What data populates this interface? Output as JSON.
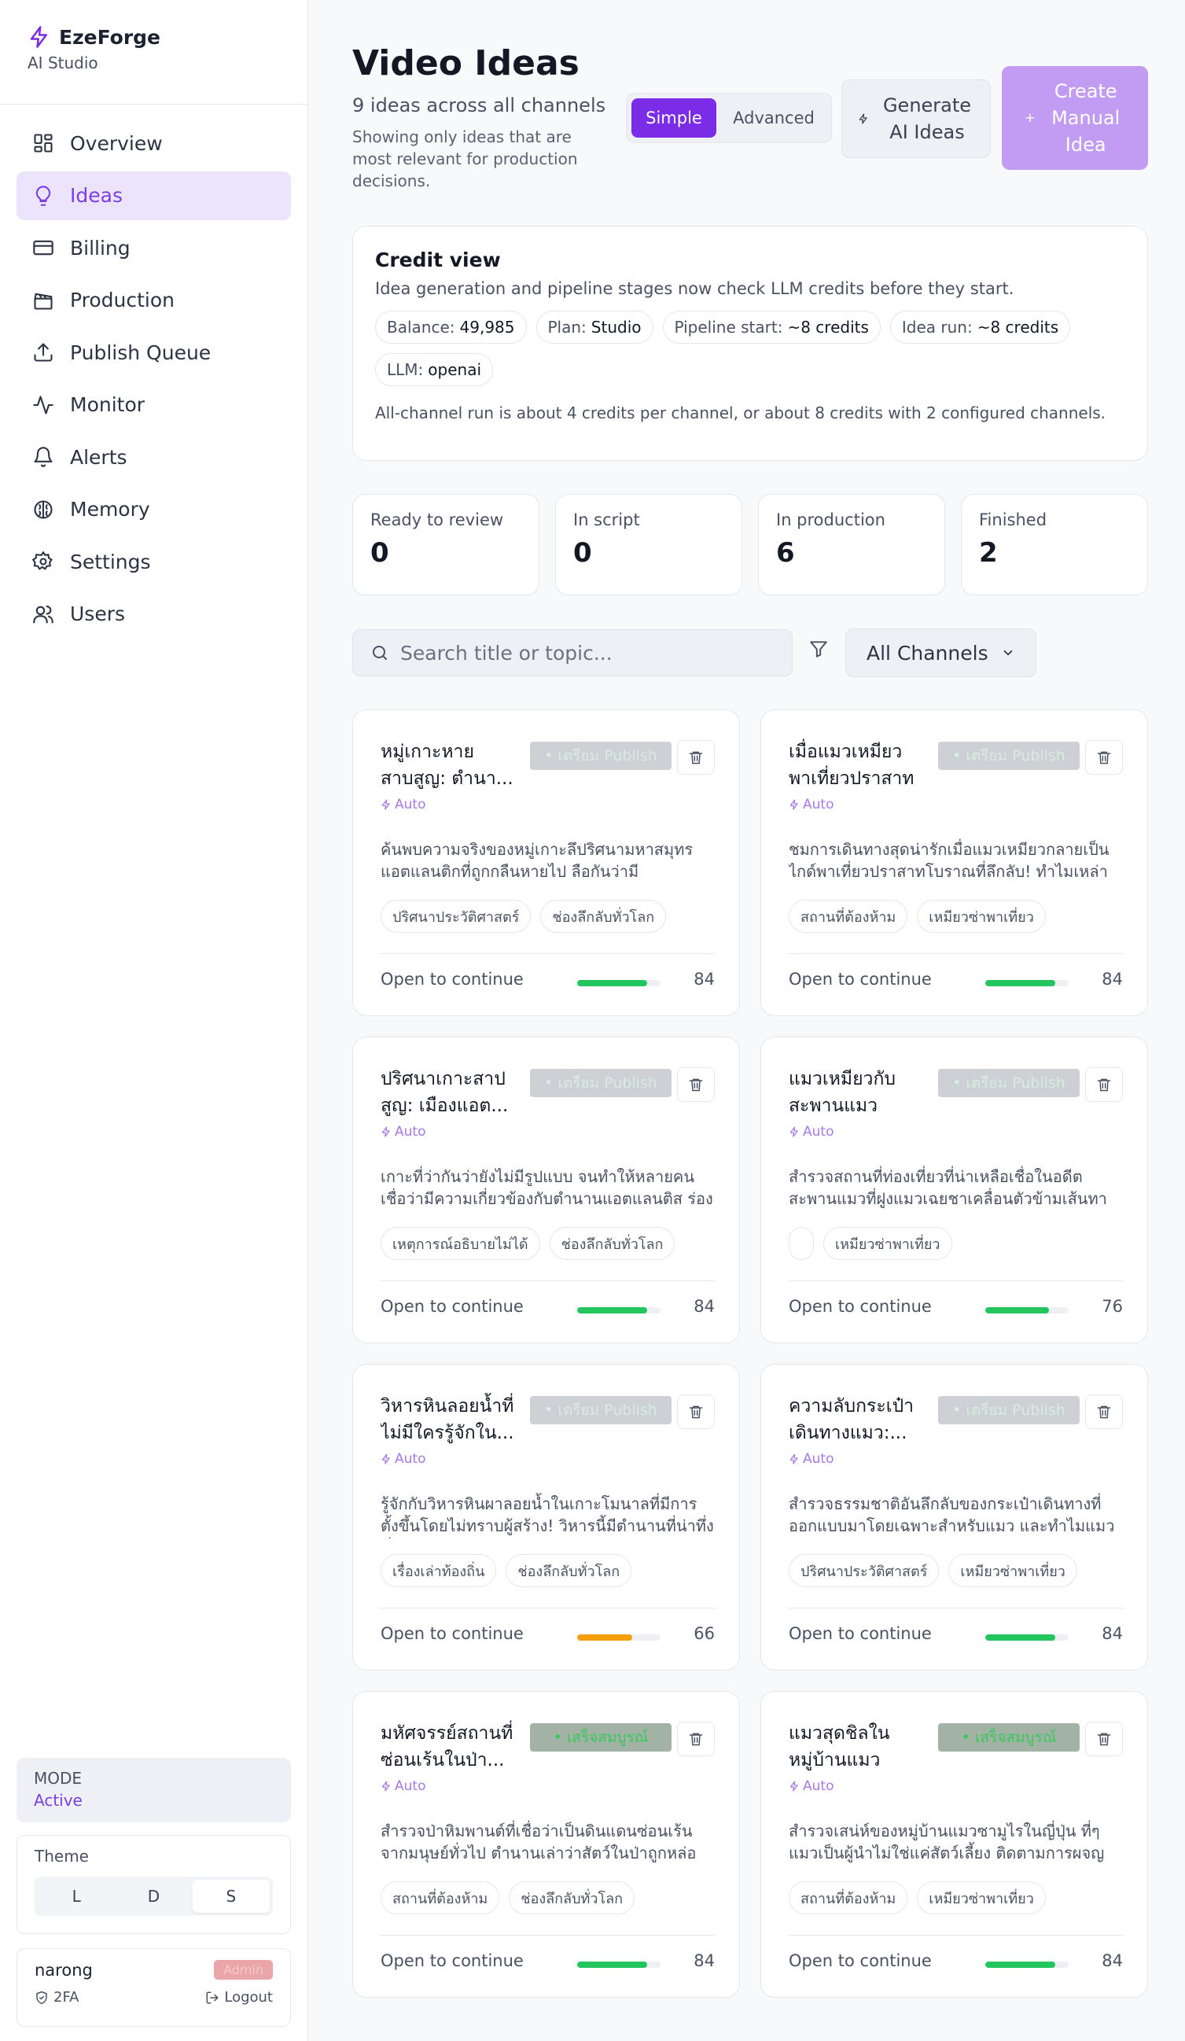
{
  "brand": {
    "name": "EzeForge",
    "sub": "AI Studio"
  },
  "nav": [
    {
      "label": "Overview",
      "icon": "grid-icon",
      "active": false
    },
    {
      "label": "Ideas",
      "icon": "lightbulb-icon",
      "active": true
    },
    {
      "label": "Billing",
      "icon": "credit-card-icon",
      "active": false
    },
    {
      "label": "Production",
      "icon": "clapperboard-icon",
      "active": false
    },
    {
      "label": "Publish Queue",
      "icon": "upload-icon",
      "active": false
    },
    {
      "label": "Monitor",
      "icon": "activity-icon",
      "active": false
    },
    {
      "label": "Alerts",
      "icon": "bell-icon",
      "active": false
    },
    {
      "label": "Memory",
      "icon": "brain-icon",
      "active": false
    },
    {
      "label": "Settings",
      "icon": "gear-icon",
      "active": false
    },
    {
      "label": "Users",
      "icon": "users-icon",
      "active": false
    }
  ],
  "mode": {
    "label": "MODE",
    "value": "Active"
  },
  "theme": {
    "label": "Theme",
    "options": [
      "L",
      "D",
      "S"
    ],
    "selected": "S"
  },
  "user": {
    "name": "narong",
    "badge": "Admin",
    "twofa": "2FA",
    "logout": "Logout"
  },
  "header": {
    "title": "Video Ideas",
    "subtitle": "9 ideas across all channels",
    "desc": "Showing only ideas that are most relevant for production decisions.",
    "seg_simple": "Simple",
    "seg_advanced": "Advanced",
    "generate": "Generate AI Ideas",
    "create": "Create Manual Idea"
  },
  "credit": {
    "title": "Credit view",
    "desc": "Idea generation and pipeline stages now check LLM credits before they start.",
    "chips": [
      {
        "k": "Balance:",
        "v": "49,985"
      },
      {
        "k": "Plan:",
        "v": "Studio"
      },
      {
        "k": "Pipeline start:",
        "v": "~8 credits"
      },
      {
        "k": "Idea run:",
        "v": "~8 credits"
      },
      {
        "k": "LLM:",
        "v": "openai"
      }
    ],
    "note": "All-channel run is about 4 credits per channel, or about 8 credits with 2 configured channels."
  },
  "stats": [
    {
      "label": "Ready to review",
      "value": "0"
    },
    {
      "label": "In script",
      "value": "0"
    },
    {
      "label": "In production",
      "value": "6"
    },
    {
      "label": "Finished",
      "value": "2"
    }
  ],
  "search": {
    "placeholder": "Search title or topic..."
  },
  "channel_filter": {
    "value": "All Channels"
  },
  "card_common": {
    "auto": "Auto",
    "open": "Open to continue"
  },
  "colors": {
    "accent": "#7b2ce6",
    "green": "#22c55e",
    "amber": "#f59e0b"
  },
  "cards": [
    {
      "title": "หมู่เกาะหาย สาบสูญ: ตำนา...",
      "status": "• เตรียม Publish",
      "status_kind": "pub",
      "desc": "ค้นพบความจริงของหมู่เกาะลึปริศนามหาสมุทรแอตแลนติกที่ถูกกลืนหายไป ลือกันว่ามีอารยธรรม...",
      "tags": [
        "ปริศนาประวัติศาสตร์",
        "ช่องลึกลับทั่วโลก"
      ],
      "score": "84",
      "progress": 0.84,
      "bar": "green"
    },
    {
      "title": "เมื่อแมวเหมียวพาเที่ยวปราสาทม...",
      "status": "• เตรียม Publish",
      "status_kind": "pub",
      "desc": "ชมการเดินทางสุดน่ารักเมื่อแมวเหมียวกลายเป็นไกด์พาเที่ยวปราสาทโบราณที่ลึกลับ! ทำไมเหล่าเหมียว...",
      "tags": [
        "สถานที่ต้องห้าม",
        "เหมียวซ่าพาเที่ยว"
      ],
      "score": "84",
      "progress": 0.84,
      "bar": "green"
    },
    {
      "title": "ปริศนาเกาะสาปสูญ: เมืองแอต...",
      "status": "• เตรียม Publish",
      "status_kind": "pub",
      "desc": "เกาะที่ว่ากันว่ายังไม่มีรูปแบบ จนทำให้หลายคนเชื่อว่ามีความเกี่ยวข้องกับตำนานแอตแลนติส ร่องรอย...",
      "tags": [
        "เหตุการณ์อธิบายไม่ได้",
        "ช่องลึกลับทั่วโลก"
      ],
      "score": "84",
      "progress": 0.84,
      "bar": "green"
    },
    {
      "title": "แมวเหมียวกับสะพานแมวแห่ง...",
      "status": "• เตรียม Publish",
      "status_kind": "pub",
      "desc": "สำรวจสถานที่ท่องเที่ยวที่น่าเหลือเชื่อในอดีตสะพานแมวที่ฝูงแมวเฉยชาเคลื่อนตัวข้ามเส้นทางอั...",
      "tags": [
        "",
        "เหมียวซ่าพาเที่ยว"
      ],
      "score": "76",
      "progress": 0.76,
      "bar": "green"
    },
    {
      "title": "วิหารหินลอยน้ำที่ไม่มีใครรู้จักใน...",
      "status": "• เตรียม Publish",
      "status_kind": "pub",
      "desc": "รู้จักกับวิหารหินผาลอยน้ำในเกาะโมนาลที่มีการตั้งขึ้นโดยไม่ทราบผู้สร้าง! วิหารนี้มีตำนานที่น่าทึ่ง ซึ่งไม่...",
      "tags": [
        "เรื่องเล่าท้องถิ่น",
        "ช่องลึกลับทั่วโลก"
      ],
      "score": "66",
      "progress": 0.66,
      "bar": "amber"
    },
    {
      "title": "ความลับกระเป๋าเดินทางแมว:...",
      "status": "• เตรียม Publish",
      "status_kind": "pub",
      "desc": "สำรวจธรรมชาติอันลึกลับของกระเป๋าเดินทางที่ออกแบบมาโดยเฉพาะสำหรับแมว และทำไมแมวถึง...",
      "tags": [
        "ปริศนาประวัติศาสตร์",
        "เหมียวซ่าพาเที่ยว"
      ],
      "score": "84",
      "progress": 0.84,
      "bar": "green"
    },
    {
      "title": "มหัศจรรย์สถานที่ซ่อนเร้นในป่า...",
      "status": "• เสร็จสมบูรณ์",
      "status_kind": "done",
      "desc": "สำรวจป่าหิมพานต์ที่เชื่อว่าเป็นดินแดนซ่อนเร้นจากมนุษย์ทั่วไป ตำนานเล่าว่าสัตว์ในป่าถูกหล่อหลอมจ...",
      "tags": [
        "สถานที่ต้องห้าม",
        "ช่องลึกลับทั่วโลก"
      ],
      "score": "84",
      "progress": 0.84,
      "bar": "green"
    },
    {
      "title": "แมวสุดชิลในหมู่บ้านแมวซามูไรญี่ปุ่น",
      "status": "• เสร็จสมบูรณ์",
      "status_kind": "done",
      "desc": "สำรวจเสน่ห์ของหมู่บ้านแมวซามูไรในญี่ปุ่น ที่ๆ แมวเป็นผู้นำไม่ใช่แค่สัตว์เลี้ยง ติดตามการผจญภัยขอ...",
      "tags": [
        "สถานที่ต้องห้าม",
        "เหมียวซ่าพาเที่ยว"
      ],
      "score": "84",
      "progress": 0.84,
      "bar": "green"
    }
  ]
}
